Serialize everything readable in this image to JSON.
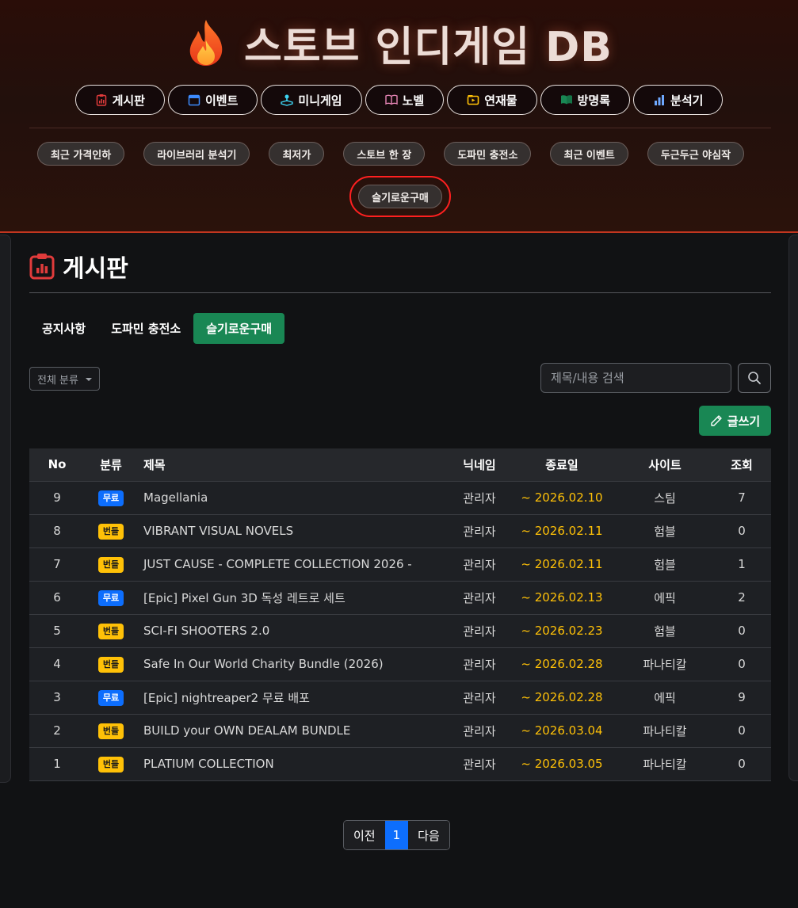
{
  "site": {
    "title": "스토브 인디게임 DB"
  },
  "main_nav": [
    {
      "label": "게시판",
      "icon": "clipboard-chart-icon",
      "color": "#e03b3b"
    },
    {
      "label": "이벤트",
      "icon": "calendar-icon",
      "color": "#3d8bfd"
    },
    {
      "label": "미니게임",
      "icon": "joystick-icon",
      "color": "#3dd5f3"
    },
    {
      "label": "노벨",
      "icon": "book-icon",
      "color": "#e685b5"
    },
    {
      "label": "연재물",
      "icon": "play-folder-icon",
      "color": "#ffc107"
    },
    {
      "label": "방명록",
      "icon": "green-book-icon",
      "color": "#198754"
    },
    {
      "label": "분석기",
      "icon": "bar-chart-icon",
      "color": "#6ea8fe"
    }
  ],
  "sub_nav": [
    "최근 가격인하",
    "라이브러리 분석기",
    "최저가",
    "스토브 한 장",
    "도파민 충전소",
    "최근 이벤트",
    "두근두근 야심작",
    "슬기로운구매"
  ],
  "board": {
    "title": "게시판",
    "tabs": [
      "공지사항",
      "도파민 충전소",
      "슬기로운구매"
    ],
    "active_tab": 2,
    "category_select": "전체 분류",
    "search_placeholder": "제목/내용 검색",
    "write_label": "글쓰기",
    "columns": [
      "No",
      "분류",
      "제목",
      "닉네임",
      "종료일",
      "사이트",
      "조회"
    ],
    "rows": [
      {
        "no": "9",
        "category": "무료",
        "type": "free",
        "title": "Magellania",
        "nick": "관리자",
        "end": "~ 2026.02.10",
        "site": "스팀",
        "views": "7"
      },
      {
        "no": "8",
        "category": "번들",
        "type": "bundle",
        "title": "VIBRANT VISUAL NOVELS",
        "nick": "관리자",
        "end": "~ 2026.02.11",
        "site": "험블",
        "views": "0"
      },
      {
        "no": "7",
        "category": "번들",
        "type": "bundle",
        "title": "JUST CAUSE - COMPLETE COLLECTION 2026 -",
        "nick": "관리자",
        "end": "~ 2026.02.11",
        "site": "험블",
        "views": "1"
      },
      {
        "no": "6",
        "category": "무료",
        "type": "free",
        "title": "[Epic] Pixel Gun 3D 독성 레트로 세트",
        "nick": "관리자",
        "end": "~ 2026.02.13",
        "site": "에픽",
        "views": "2"
      },
      {
        "no": "5",
        "category": "번들",
        "type": "bundle",
        "title": "SCI-FI SHOOTERS 2.0",
        "nick": "관리자",
        "end": "~ 2026.02.23",
        "site": "험블",
        "views": "0"
      },
      {
        "no": "4",
        "category": "번들",
        "type": "bundle",
        "title": "Safe In Our World Charity Bundle (2026)",
        "nick": "관리자",
        "end": "~ 2026.02.28",
        "site": "파나티칼",
        "views": "0"
      },
      {
        "no": "3",
        "category": "무료",
        "type": "free",
        "title": "[Epic] nightreaper2 무료 배포",
        "nick": "관리자",
        "end": "~ 2026.02.28",
        "site": "에픽",
        "views": "9"
      },
      {
        "no": "2",
        "category": "번들",
        "type": "bundle",
        "title": "BUILD your OWN DEALAM BUNDLE",
        "nick": "관리자",
        "end": "~ 2026.03.04",
        "site": "파나티칼",
        "views": "0"
      },
      {
        "no": "1",
        "category": "번들",
        "type": "bundle",
        "title": "PLATIUM COLLECTION",
        "nick": "관리자",
        "end": "~ 2026.03.05",
        "site": "파나티칼",
        "views": "0"
      }
    ]
  },
  "pagination": {
    "prev": "이전",
    "current": "1",
    "next": "다음"
  },
  "colors": {
    "accent_green": "#198754",
    "badge_free": "#0d6efd",
    "badge_bundle": "#ffc107",
    "date_yellow": "#ffc107"
  }
}
